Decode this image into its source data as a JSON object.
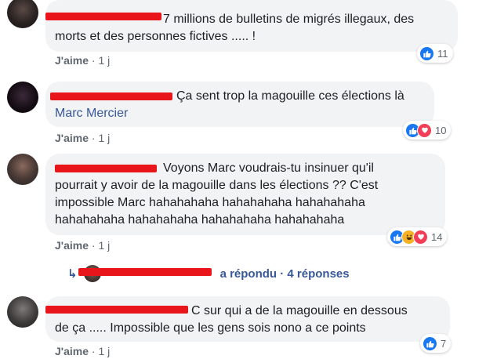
{
  "comments": [
    {
      "text_after_name": "7 millions de bulletins de migrés illegaux, des morts et des personnes fictives ..... !",
      "line1": "7 millions de bulletins de migrés illegaux, des",
      "line2": "morts et des personnes fictives ..... !",
      "like_label": "J'aime",
      "time": "1 j",
      "reactions": [
        "like"
      ],
      "reaction_count": "11"
    },
    {
      "line1": "Ça sent trop la magouille ces élections là",
      "tagged_name": "Marc Mercier",
      "like_label": "J'aime",
      "time": "1 j",
      "reactions": [
        "like",
        "love"
      ],
      "reaction_count": "10"
    },
    {
      "line1": "Voyons Marc voudrais-tu insinuer qu'il",
      "line2": "pourrait y avoir de la magouille dans les élections ?? C'est",
      "line3": "impossible Marc hahahahaha hahahahaha hahahahaha",
      "line4": "hahahahaha hahahahaha hahahahaha hahahahaha",
      "like_label": "J'aime",
      "time": "1 j",
      "reactions": [
        "like",
        "haha",
        "love"
      ],
      "reaction_count": "14",
      "replies_text": "a répondu · 4 réponses"
    },
    {
      "line1": "C sur qui a de la magouille en dessous",
      "line2": "de ça ..... Impossible que les gens sois nono a ce points",
      "like_label": "J'aime",
      "time": "1 j",
      "reactions": [
        "like"
      ],
      "reaction_count": "7"
    }
  ],
  "meta_separator": "·",
  "colors": {
    "link": "#385898",
    "redaction": "#e8151b",
    "bubble": "#f2f3f5",
    "like": "#1877f2",
    "love": "#f33e58",
    "haha": "#f7b125"
  }
}
